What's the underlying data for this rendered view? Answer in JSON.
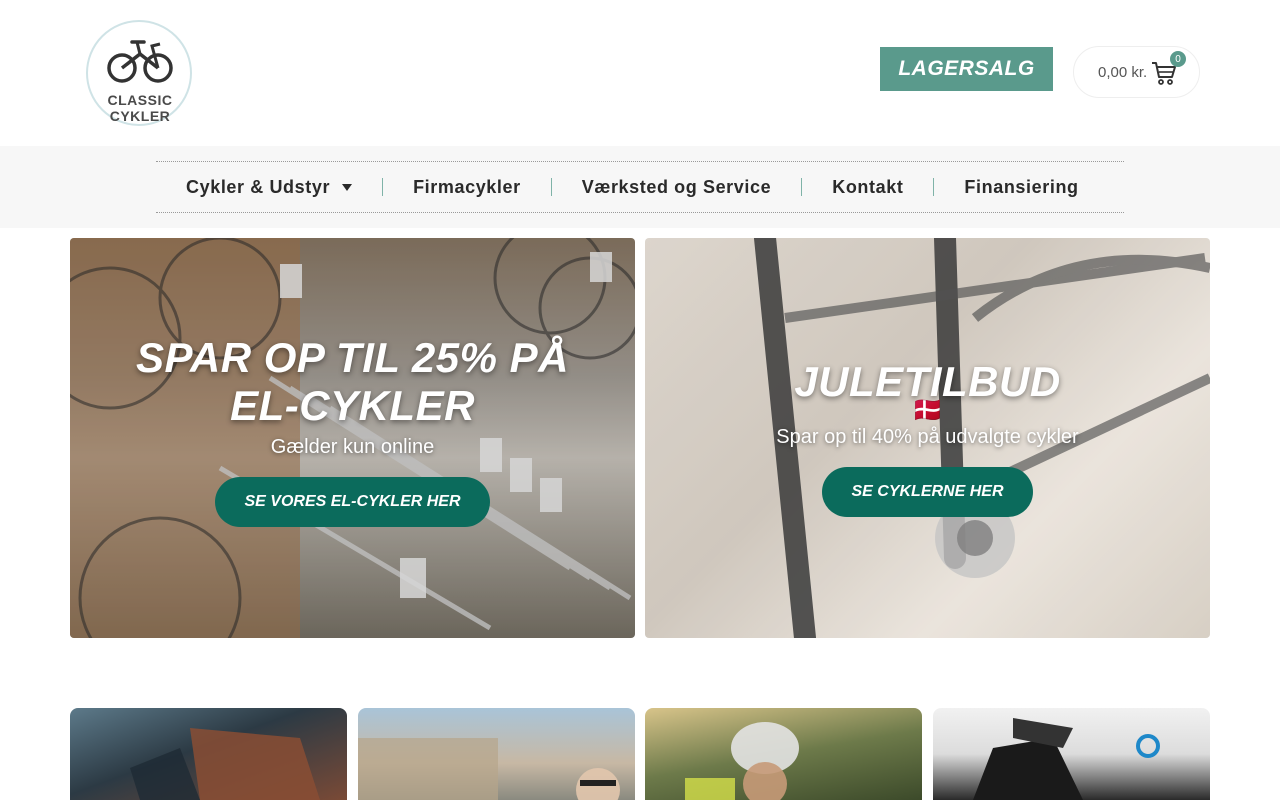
{
  "header": {
    "logo_text": "CLASSIC CYKLER",
    "lagersalg_label": "LAGERSALG",
    "cart": {
      "total": "0,00 kr.",
      "count": "0"
    }
  },
  "nav": {
    "items": [
      {
        "label": "Cykler & Udstyr",
        "has_dropdown": true
      },
      {
        "label": "Firmacykler"
      },
      {
        "label": "Værksted og Service"
      },
      {
        "label": "Kontakt"
      },
      {
        "label": "Finansiering"
      }
    ]
  },
  "banners": [
    {
      "title_line1": "SPAR OP TIL 25% PÅ",
      "title_line2": "EL-CYKLER",
      "subtitle": "Gælder kun online",
      "button": "SE VORES EL-CYKLER HER"
    },
    {
      "title": "JULETILBUD",
      "flag": "🇩🇰",
      "subtitle": "Spar op til 40% på udvalgte cykler",
      "button": "SE CYKLERNE HER"
    }
  ],
  "colors": {
    "accent": "#5a9a8c",
    "button": "#0b6b5c",
    "nav_bg": "#f7f7f7"
  },
  "icons": [
    "bicycle-logo-icon",
    "cart-icon",
    "chevron-down-icon",
    "danish-flag-icon"
  ]
}
